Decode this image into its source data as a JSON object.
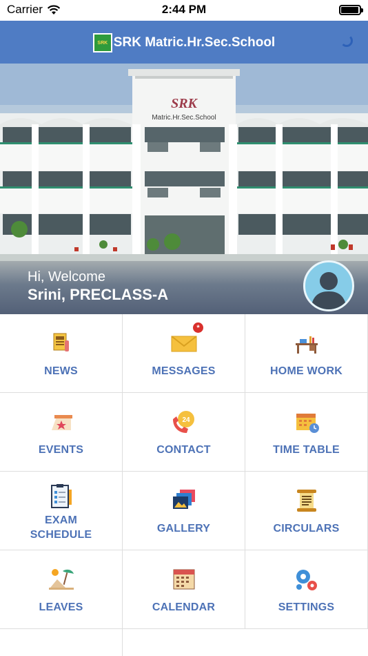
{
  "status_bar": {
    "carrier": "Carrier",
    "time": "2:44 PM"
  },
  "header": {
    "title": "SRK Matric.Hr.Sec.School",
    "logo_text": "SRK"
  },
  "hero": {
    "sign_text": "SRK",
    "sign_subtext": "Matric.Hr.Sec.School",
    "welcome": "Hi, Welcome",
    "user": "Srini, PRECLASS-A"
  },
  "menu": [
    {
      "label": "NEWS",
      "icon": "newspaper-icon"
    },
    {
      "label": "MESSAGES",
      "icon": "envelope-icon",
      "badge": "*"
    },
    {
      "label": "HOME WORK",
      "icon": "desk-icon"
    },
    {
      "label": "EVENTS",
      "icon": "event-tent-icon"
    },
    {
      "label": "CONTACT",
      "icon": "phone-24-icon"
    },
    {
      "label": "TIME TABLE",
      "icon": "calendar-clock-icon"
    },
    {
      "label": "EXAM SCHEDULE",
      "icon": "checklist-icon"
    },
    {
      "label": "GALLERY",
      "icon": "photos-icon"
    },
    {
      "label": "CIRCULARS",
      "icon": "scroll-icon"
    },
    {
      "label": "LEAVES",
      "icon": "beach-icon"
    },
    {
      "label": "CALENDAR",
      "icon": "calendar-icon"
    },
    {
      "label": "SETTINGS",
      "icon": "gears-icon"
    },
    {
      "label": "",
      "icon": "notes-icon"
    }
  ],
  "colors": {
    "header": "#4f7cc4",
    "label": "#4d72b6",
    "badge": "#d9302c"
  }
}
